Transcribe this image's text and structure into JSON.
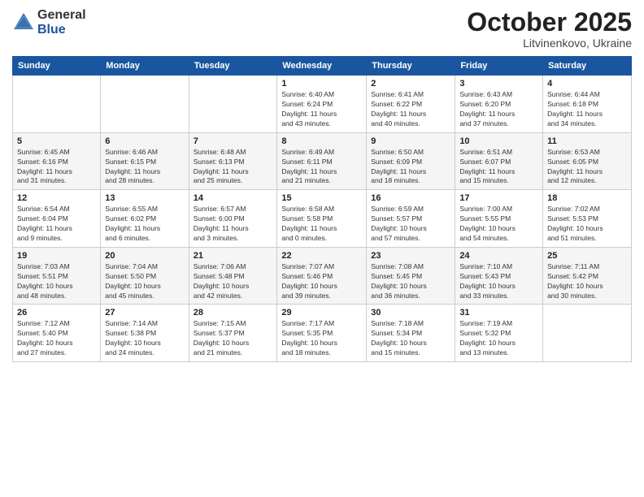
{
  "logo": {
    "general": "General",
    "blue": "Blue"
  },
  "title": "October 2025",
  "subtitle": "Litvinenkovo, Ukraine",
  "days_header": [
    "Sunday",
    "Monday",
    "Tuesday",
    "Wednesday",
    "Thursday",
    "Friday",
    "Saturday"
  ],
  "weeks": [
    [
      {
        "day": "",
        "info": ""
      },
      {
        "day": "",
        "info": ""
      },
      {
        "day": "",
        "info": ""
      },
      {
        "day": "1",
        "info": "Sunrise: 6:40 AM\nSunset: 6:24 PM\nDaylight: 11 hours\nand 43 minutes."
      },
      {
        "day": "2",
        "info": "Sunrise: 6:41 AM\nSunset: 6:22 PM\nDaylight: 11 hours\nand 40 minutes."
      },
      {
        "day": "3",
        "info": "Sunrise: 6:43 AM\nSunset: 6:20 PM\nDaylight: 11 hours\nand 37 minutes."
      },
      {
        "day": "4",
        "info": "Sunrise: 6:44 AM\nSunset: 6:18 PM\nDaylight: 11 hours\nand 34 minutes."
      }
    ],
    [
      {
        "day": "5",
        "info": "Sunrise: 6:45 AM\nSunset: 6:16 PM\nDaylight: 11 hours\nand 31 minutes."
      },
      {
        "day": "6",
        "info": "Sunrise: 6:46 AM\nSunset: 6:15 PM\nDaylight: 11 hours\nand 28 minutes."
      },
      {
        "day": "7",
        "info": "Sunrise: 6:48 AM\nSunset: 6:13 PM\nDaylight: 11 hours\nand 25 minutes."
      },
      {
        "day": "8",
        "info": "Sunrise: 6:49 AM\nSunset: 6:11 PM\nDaylight: 11 hours\nand 21 minutes."
      },
      {
        "day": "9",
        "info": "Sunrise: 6:50 AM\nSunset: 6:09 PM\nDaylight: 11 hours\nand 18 minutes."
      },
      {
        "day": "10",
        "info": "Sunrise: 6:51 AM\nSunset: 6:07 PM\nDaylight: 11 hours\nand 15 minutes."
      },
      {
        "day": "11",
        "info": "Sunrise: 6:53 AM\nSunset: 6:05 PM\nDaylight: 11 hours\nand 12 minutes."
      }
    ],
    [
      {
        "day": "12",
        "info": "Sunrise: 6:54 AM\nSunset: 6:04 PM\nDaylight: 11 hours\nand 9 minutes."
      },
      {
        "day": "13",
        "info": "Sunrise: 6:55 AM\nSunset: 6:02 PM\nDaylight: 11 hours\nand 6 minutes."
      },
      {
        "day": "14",
        "info": "Sunrise: 6:57 AM\nSunset: 6:00 PM\nDaylight: 11 hours\nand 3 minutes."
      },
      {
        "day": "15",
        "info": "Sunrise: 6:58 AM\nSunset: 5:58 PM\nDaylight: 11 hours\nand 0 minutes."
      },
      {
        "day": "16",
        "info": "Sunrise: 6:59 AM\nSunset: 5:57 PM\nDaylight: 10 hours\nand 57 minutes."
      },
      {
        "day": "17",
        "info": "Sunrise: 7:00 AM\nSunset: 5:55 PM\nDaylight: 10 hours\nand 54 minutes."
      },
      {
        "day": "18",
        "info": "Sunrise: 7:02 AM\nSunset: 5:53 PM\nDaylight: 10 hours\nand 51 minutes."
      }
    ],
    [
      {
        "day": "19",
        "info": "Sunrise: 7:03 AM\nSunset: 5:51 PM\nDaylight: 10 hours\nand 48 minutes."
      },
      {
        "day": "20",
        "info": "Sunrise: 7:04 AM\nSunset: 5:50 PM\nDaylight: 10 hours\nand 45 minutes."
      },
      {
        "day": "21",
        "info": "Sunrise: 7:06 AM\nSunset: 5:48 PM\nDaylight: 10 hours\nand 42 minutes."
      },
      {
        "day": "22",
        "info": "Sunrise: 7:07 AM\nSunset: 5:46 PM\nDaylight: 10 hours\nand 39 minutes."
      },
      {
        "day": "23",
        "info": "Sunrise: 7:08 AM\nSunset: 5:45 PM\nDaylight: 10 hours\nand 36 minutes."
      },
      {
        "day": "24",
        "info": "Sunrise: 7:10 AM\nSunset: 5:43 PM\nDaylight: 10 hours\nand 33 minutes."
      },
      {
        "day": "25",
        "info": "Sunrise: 7:11 AM\nSunset: 5:42 PM\nDaylight: 10 hours\nand 30 minutes."
      }
    ],
    [
      {
        "day": "26",
        "info": "Sunrise: 7:12 AM\nSunset: 5:40 PM\nDaylight: 10 hours\nand 27 minutes."
      },
      {
        "day": "27",
        "info": "Sunrise: 7:14 AM\nSunset: 5:38 PM\nDaylight: 10 hours\nand 24 minutes."
      },
      {
        "day": "28",
        "info": "Sunrise: 7:15 AM\nSunset: 5:37 PM\nDaylight: 10 hours\nand 21 minutes."
      },
      {
        "day": "29",
        "info": "Sunrise: 7:17 AM\nSunset: 5:35 PM\nDaylight: 10 hours\nand 18 minutes."
      },
      {
        "day": "30",
        "info": "Sunrise: 7:18 AM\nSunset: 5:34 PM\nDaylight: 10 hours\nand 15 minutes."
      },
      {
        "day": "31",
        "info": "Sunrise: 7:19 AM\nSunset: 5:32 PM\nDaylight: 10 hours\nand 13 minutes."
      },
      {
        "day": "",
        "info": ""
      }
    ]
  ]
}
